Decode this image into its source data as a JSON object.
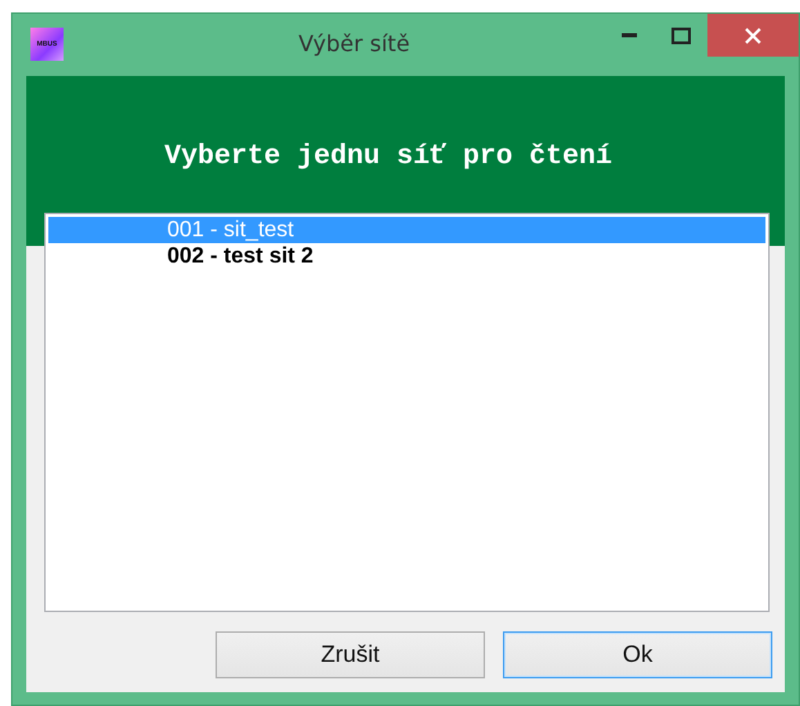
{
  "window": {
    "title": "Výběr sítě",
    "icon_label": "MBUS"
  },
  "header": "Vyberte jednu síť pro čtení",
  "networks": [
    {
      "label": "001 - sit_test",
      "selected": true
    },
    {
      "label": "002 - test sit 2",
      "selected": false
    }
  ],
  "buttons": [
    {
      "label": "Zrušit",
      "default": false
    },
    {
      "label": "Ok",
      "default": true
    }
  ]
}
